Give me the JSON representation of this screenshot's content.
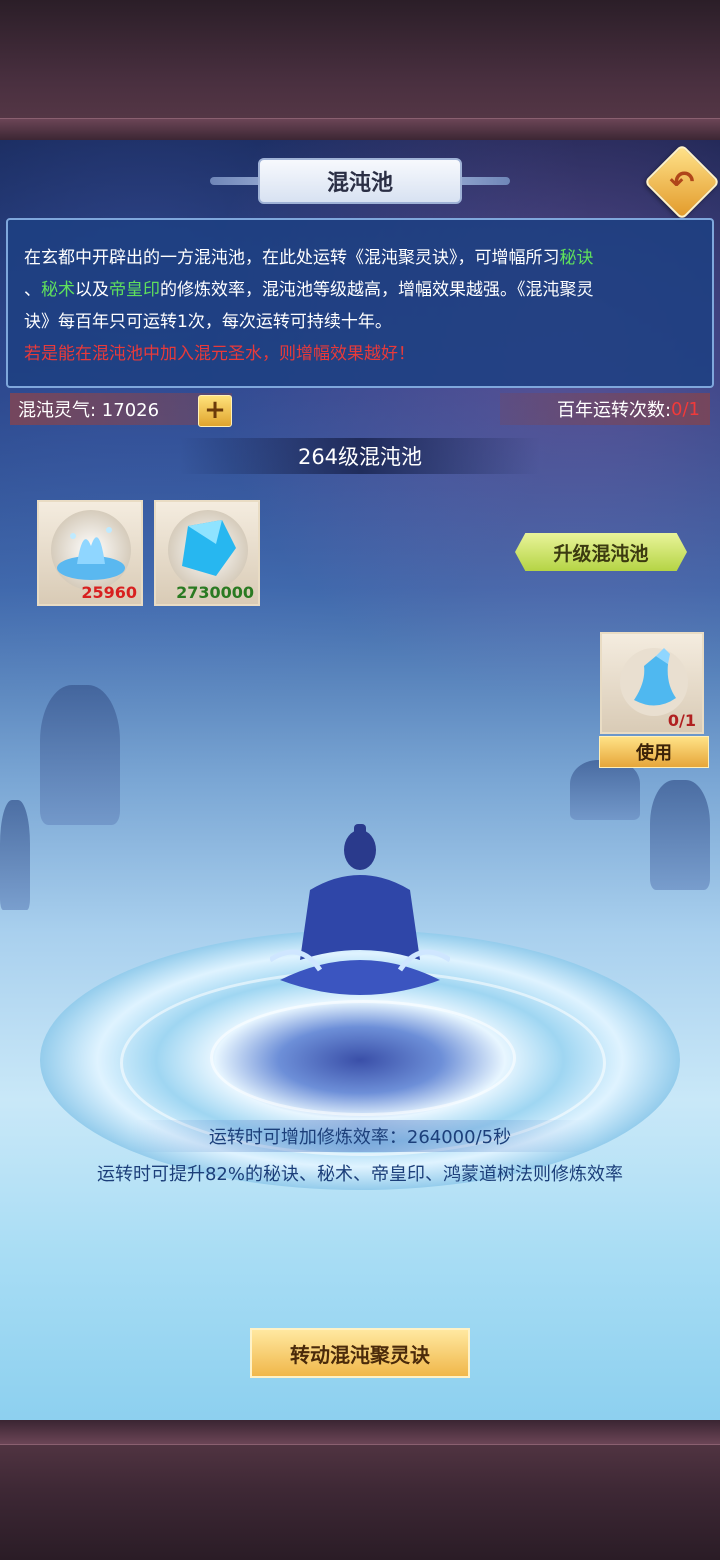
{
  "header": {
    "title": "混沌池",
    "back_icon": "back-arrow-icon"
  },
  "description": {
    "p1": "在玄都中开辟出的一方混沌池，在此处运转《混沌聚灵诀》，可增幅所习",
    "p1_green": "秘诀",
    "p2_lead": "、",
    "p2_green1": "秘术",
    "p2_mid": "以及",
    "p2_green2": "帝皇印",
    "p2_rest": "的修炼效率，混沌池等级越高，增幅效果越强。《混沌聚灵",
    "p3": "诀》每百年只可运转1次，每次运转可持续十年。",
    "p4_red": "若是能在混沌池中加入混元圣水，则增幅效果越好！"
  },
  "resources": {
    "qi_label": "混沌灵气: 17026",
    "plus_label": "+",
    "count_label": "百年运转次数:",
    "count_value": "0/1"
  },
  "level": {
    "text": "264级混沌池"
  },
  "cost_items": [
    {
      "name": "混沌灵泉",
      "qty": "25960",
      "qty_color": "#d82020"
    },
    {
      "name": "灵晶",
      "qty": "2730000",
      "qty_color": "#2a7a22"
    }
  ],
  "upgrade_button": "升级混沌池",
  "potion": {
    "qty": "0/1",
    "use_label": "使用"
  },
  "rate_text": "运转时可增加修炼效率：264000/5秒",
  "boost_text": "运转时可提升82%的秘诀、秘术、帝皇印、鸿蒙道树法则修炼效率",
  "start_button": "转动混沌聚灵诀",
  "colors": {
    "green": "#5fe05c",
    "red": "#e83a3a",
    "accent_gold": "#f0b74a"
  }
}
